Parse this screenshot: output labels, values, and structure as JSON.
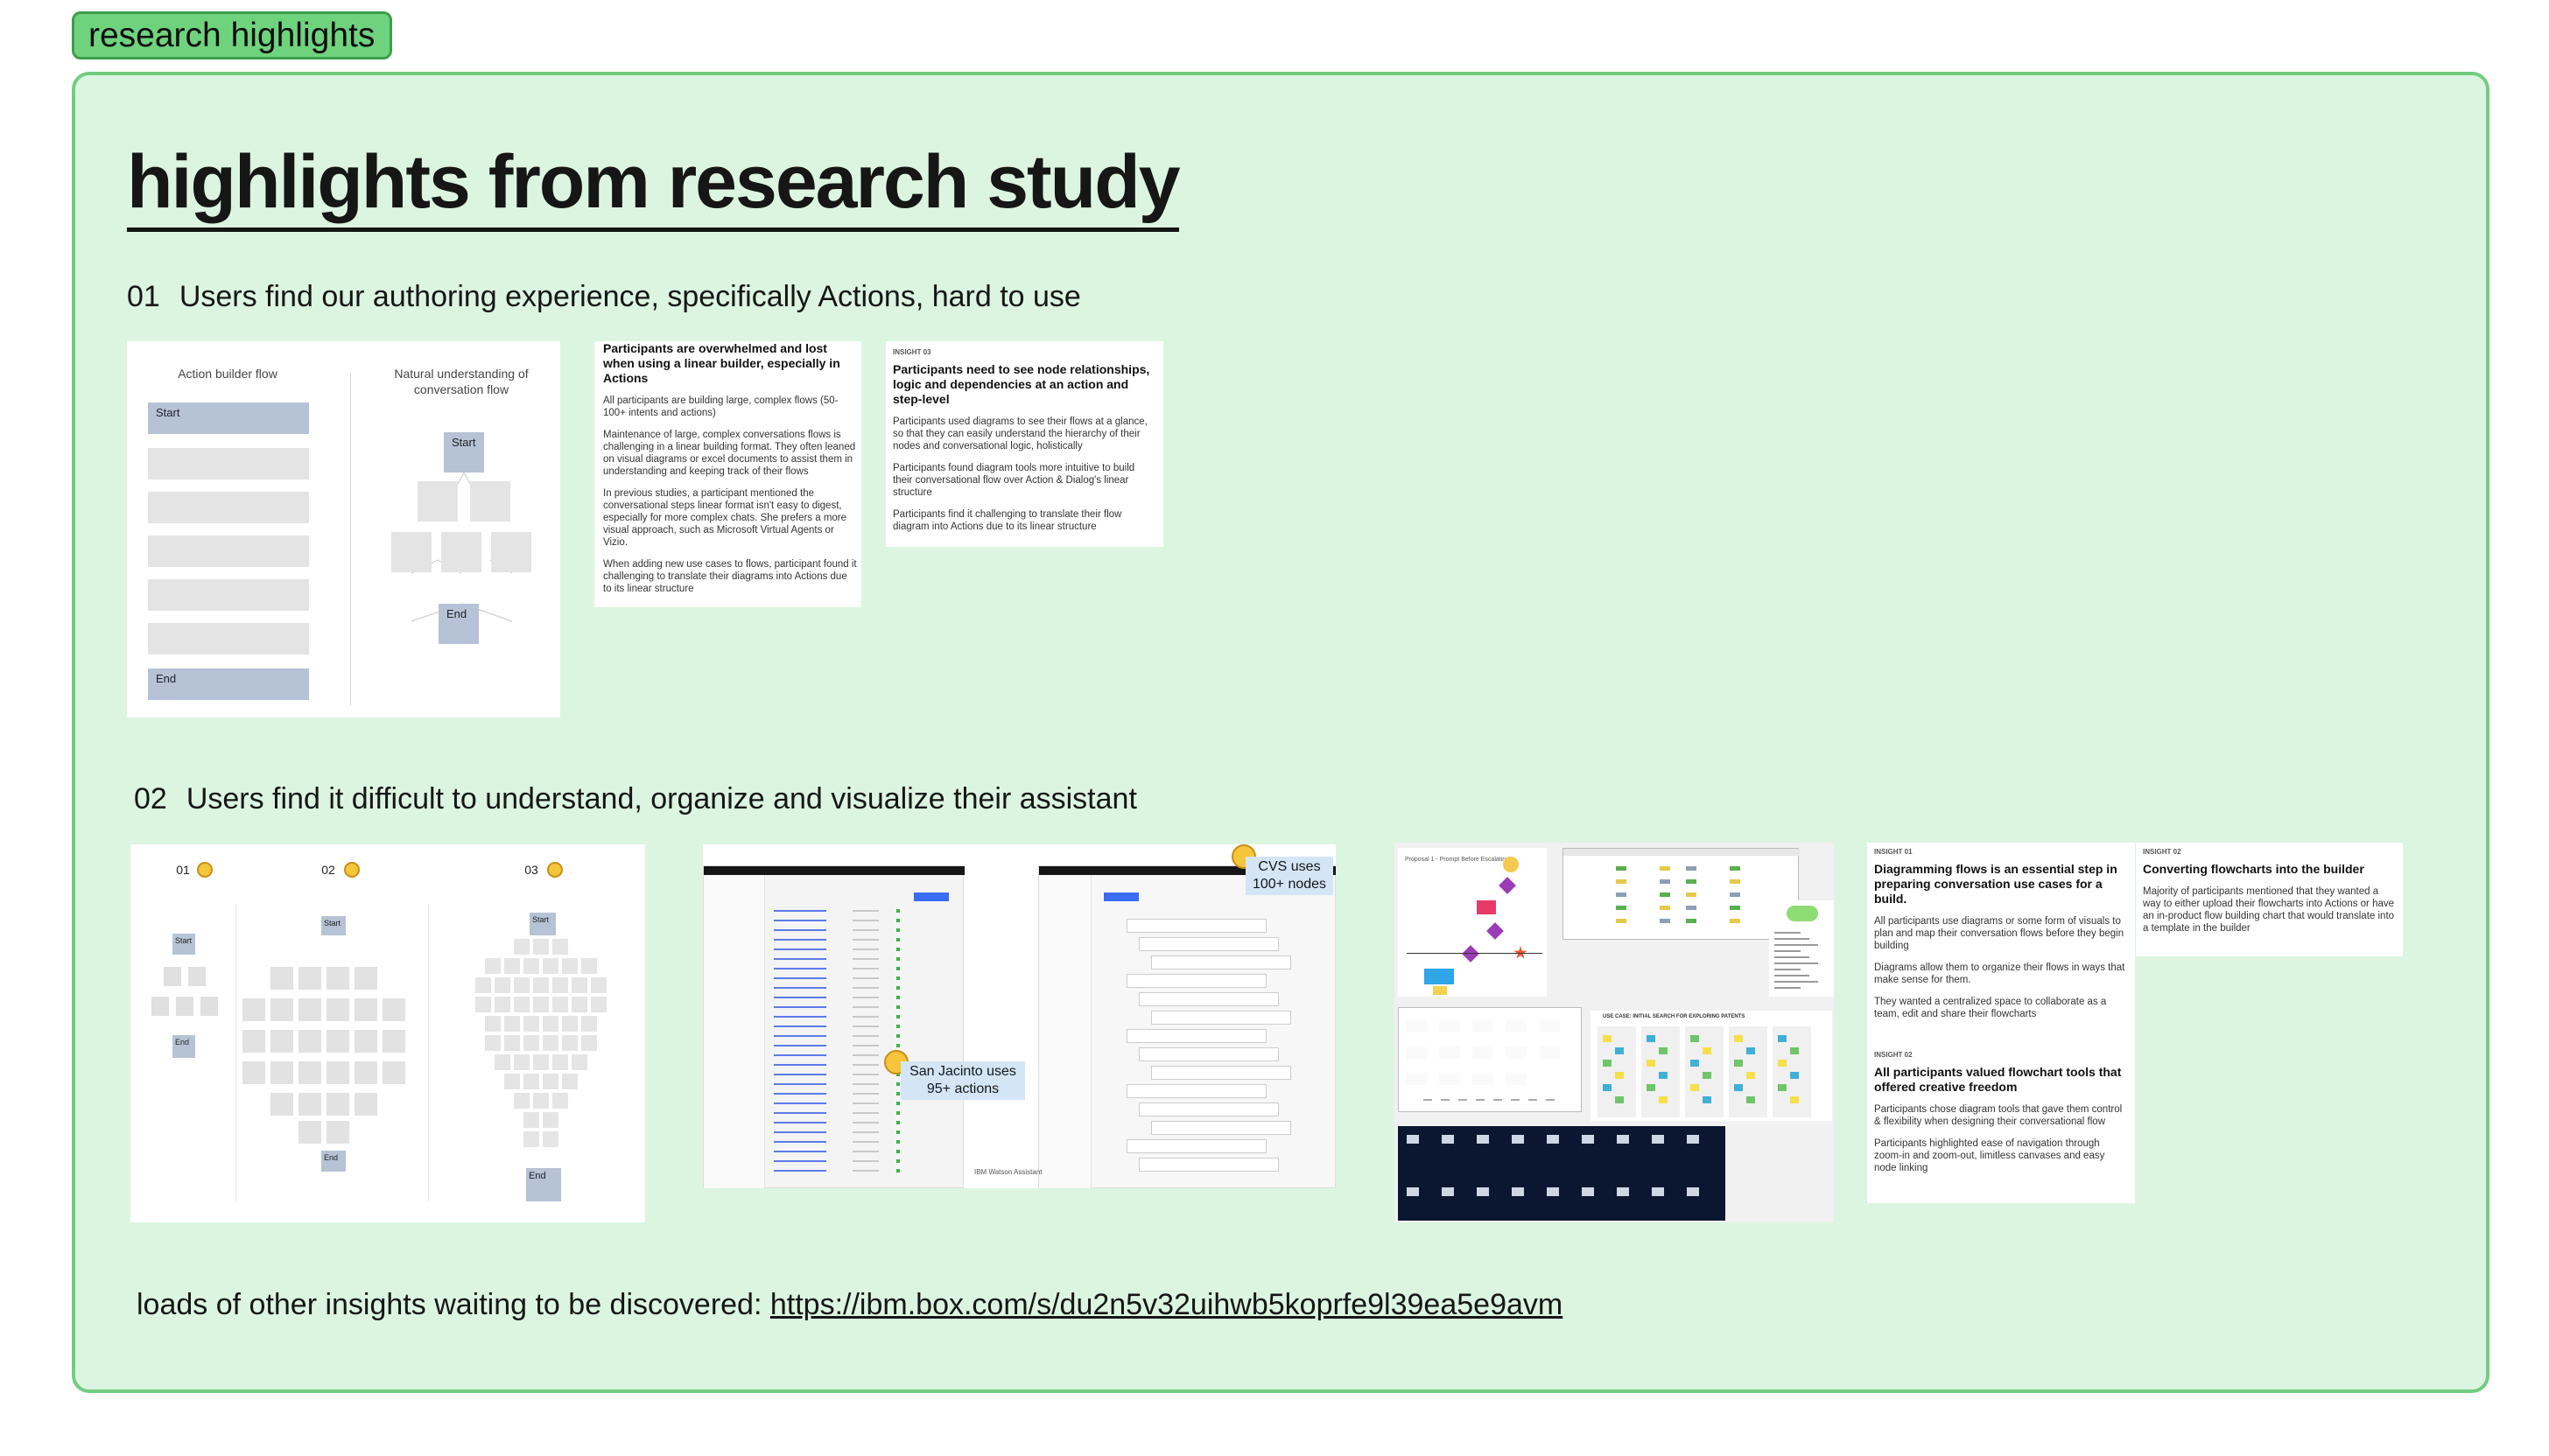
{
  "tag_label": "research highlights",
  "page_title": "highlights from research study",
  "section1": {
    "number": "01",
    "text": "Users find our authoring experience, specifically Actions, hard to use"
  },
  "section2": {
    "number": "02",
    "text": "Users find it difficult to understand, organize and visualize their assistant"
  },
  "flow_card": {
    "left_heading": "Action builder flow",
    "right_heading": "Natural understanding of conversation flow",
    "start": "Start",
    "end": "End"
  },
  "insight_a": {
    "heading": "Participants are overwhelmed and lost when using a linear builder, especially in Actions",
    "bullets": [
      "All participants are building large, complex flows (50-100+ intents and actions)",
      "Maintenance of large, complex conversations flows is challenging in a linear building format. They often leaned on visual diagrams or excel documents to assist them in understanding and keeping track of their flows",
      "In previous studies, a participant mentioned the conversational steps linear format isn't easy to digest, especially for more complex chats. She prefers a more visual approach, such as Microsoft Virtual Agents or Vizio.",
      "When adding new use cases to flows, participant found it challenging to translate their diagrams into Actions due to its linear structure"
    ]
  },
  "insight_b": {
    "label": "INSIGHT 03",
    "heading": "Participants need to see node relationships, logic and dependencies at an action and step-level",
    "bullets": [
      "Participants used diagrams to see their flows at a glance, so that they can easily understand the hierarchy of their nodes and conversational logic, holistically",
      "Participants found diagram tools more intuitive to build their conversational flow over Action & Dialog's linear structure",
      "Participants find it challenging to translate their flow diagram into Actions due to its linear structure"
    ]
  },
  "evolution_card": {
    "labels": [
      "01",
      "02",
      "03"
    ],
    "start": "Start",
    "end": "End"
  },
  "screens_card": {
    "badge_top": "CVS uses 100+ nodes",
    "badge_bottom": "San Jacinto uses 95+ actions",
    "brand": "IBM Watson Assistant"
  },
  "collage_card": {
    "label": "Proposal 1 - Prompt Before Escalating",
    "usecase": "USE CASE: INITIAL SEARCH FOR EXPLORING PATENTS"
  },
  "insight_c": {
    "label": "INSIGHT 01",
    "heading": "Diagramming flows is an essential step in preparing conversation use cases for a build.",
    "bullets": [
      "All participants use diagrams or some form of visuals to plan and map their conversation flows before they begin building",
      "Diagrams allow them to organize their flows in ways that make sense for them.",
      "They wanted a centralized space to collaborate as a team, edit and share their flowcharts"
    ]
  },
  "insight_d": {
    "label": "INSIGHT 02",
    "heading": "Converting flowcharts into the builder",
    "bullets": [
      "Majority of participants mentioned that they wanted a way to either upload their flowcharts into Actions or have an in-product flow building chart that would translate into a template in the builder"
    ]
  },
  "insight_e": {
    "label": "INSIGHT 02",
    "heading": "All participants valued flowchart tools that offered creative freedom",
    "bullets": [
      "Participants chose diagram tools that gave them control & flexibility when designing their conversational flow",
      "Participants highlighted ease of navigation through zoom-in and zoom-out, limitless canvases and easy node linking"
    ]
  },
  "footer": {
    "text": "loads of other insights waiting to be discovered:",
    "link": "https://ibm.box.com/s/du2n5v32uihwb5koprfe9l39ea5e9avm"
  }
}
